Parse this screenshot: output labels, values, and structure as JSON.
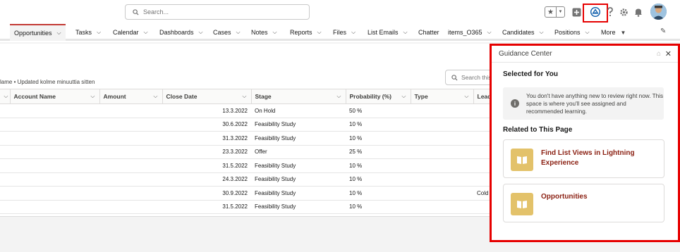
{
  "header": {
    "search_placeholder": "Search...",
    "icons": [
      "search-icon",
      "star-icon",
      "add-icon",
      "guidance-center-icon",
      "help-icon",
      "gear-icon",
      "bell-icon",
      "avatar"
    ]
  },
  "nav": {
    "items": [
      {
        "label": "Opportunities",
        "chevron": true,
        "active": true
      },
      {
        "label": "Tasks",
        "chevron": true
      },
      {
        "label": "Calendar",
        "chevron": true
      },
      {
        "label": "Dashboards",
        "chevron": true
      },
      {
        "label": "Cases",
        "chevron": true
      },
      {
        "label": "Notes",
        "chevron": true
      },
      {
        "label": "Reports",
        "chevron": true
      },
      {
        "label": "Files",
        "chevron": true
      },
      {
        "label": "List Emails",
        "chevron": true
      },
      {
        "label": "Chatter",
        "chevron": false
      },
      {
        "label": "items_O365",
        "chevron": true
      },
      {
        "label": "Candidates",
        "chevron": true
      },
      {
        "label": "Positions",
        "chevron": true
      },
      {
        "label": "More",
        "chevron": true
      }
    ]
  },
  "list": {
    "meta_text": "lame • Updated kolme minuuttia sitten",
    "search_placeholder": "Search this",
    "columns": [
      "",
      "Account Name",
      "Amount",
      "Close Date",
      "Stage",
      "Probability (%)",
      "Type",
      "Lead"
    ],
    "rows": [
      {
        "close_date": "13.3.2022",
        "stage": "On Hold",
        "probability": "50 %",
        "lead": ""
      },
      {
        "close_date": "30.6.2022",
        "stage": "Feasibility Study",
        "probability": "10 %",
        "lead": ""
      },
      {
        "close_date": "31.3.2022",
        "stage": "Feasibility Study",
        "probability": "10 %",
        "lead": ""
      },
      {
        "close_date": "23.3.2022",
        "stage": "Offer",
        "probability": "25 %",
        "lead": ""
      },
      {
        "close_date": "31.5.2022",
        "stage": "Feasibility Study",
        "probability": "10 %",
        "lead": ""
      },
      {
        "close_date": "24.3.2022",
        "stage": "Feasibility Study",
        "probability": "10 %",
        "lead": ""
      },
      {
        "close_date": "30.9.2022",
        "stage": "Feasibility Study",
        "probability": "10 %",
        "lead": "Cold"
      },
      {
        "close_date": "31.5.2022",
        "stage": "Feasibility Study",
        "probability": "10 %",
        "lead": ""
      }
    ]
  },
  "guidance": {
    "title": "Guidance Center",
    "selected_heading": "Selected for You",
    "info_text": "You don't have anything new to review right now. This space is where you'll see assigned and recommended learning.",
    "related_heading": "Related to This Page",
    "cards": [
      {
        "title": "Find List Views in Lightning Experience"
      },
      {
        "title": "Opportunities"
      }
    ]
  },
  "colors": {
    "highlight": "#e60000",
    "link": "#8a1f11",
    "card_icon_bg": "#e3c26a",
    "nav_active": "#c23934"
  }
}
